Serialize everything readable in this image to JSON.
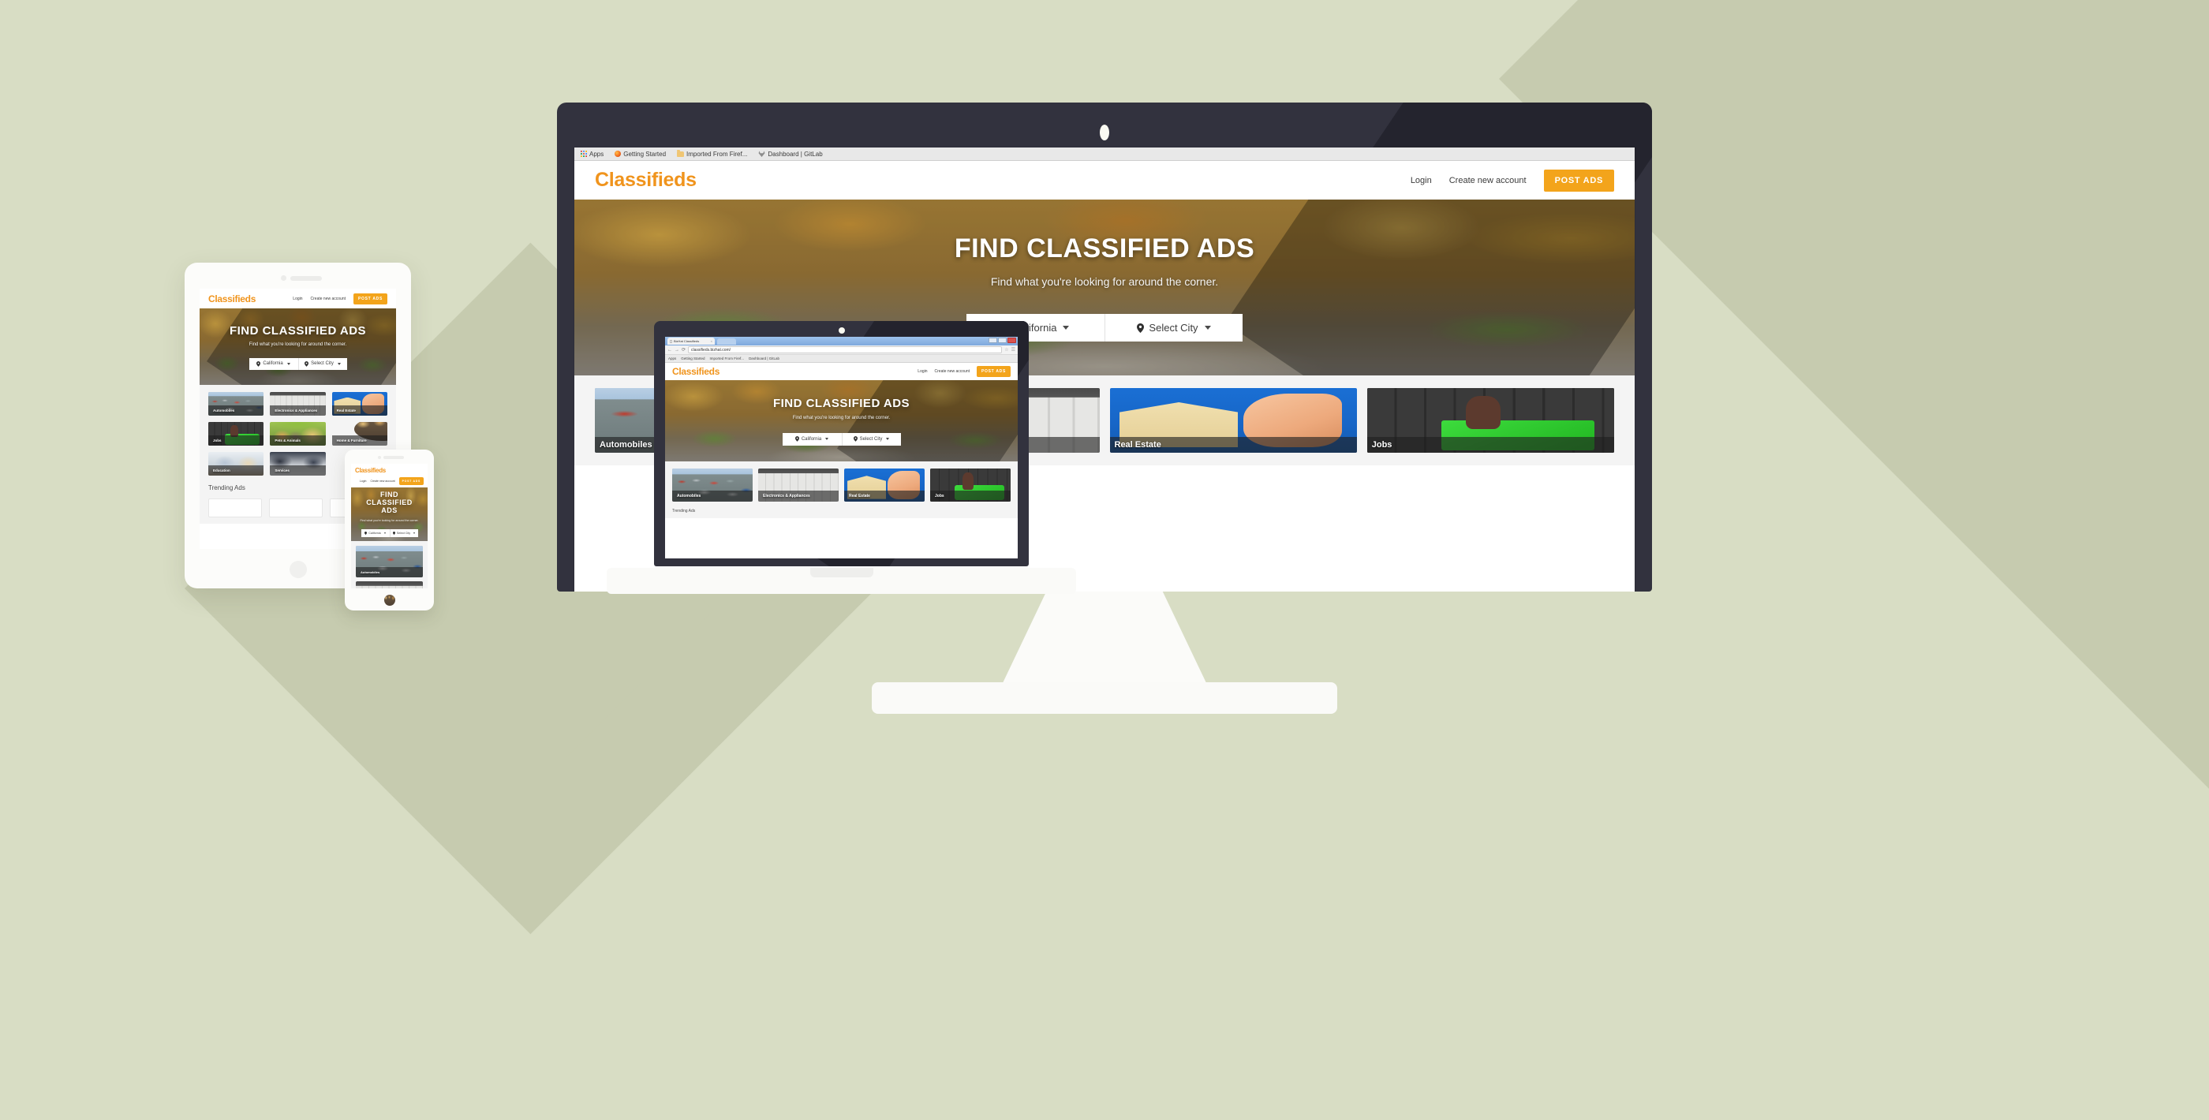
{
  "background": {
    "base_color": "#d8ddc4",
    "shadow_color": "#c6cbaf"
  },
  "browser": {
    "tab_title": "BizHat Classifieds",
    "url": "classifieds.bizhat.com/",
    "bookmarks": [
      {
        "label": "Apps",
        "icon": "apps-grid-icon"
      },
      {
        "label": "Getting Started",
        "icon": "firefox-icon"
      },
      {
        "label": "Imported From Firef...",
        "icon": "folder-icon"
      },
      {
        "label": "Dashboard | GitLab",
        "icon": "gitlab-icon"
      }
    ],
    "window_controls": [
      "minimize",
      "maximize",
      "close"
    ],
    "nav_icons": [
      "back-arrow",
      "forward-arrow",
      "reload",
      "star",
      "menu"
    ]
  },
  "site": {
    "brand": "Classifieds",
    "brand_color": "#f0941d",
    "nav": {
      "login": "Login",
      "create_account": "Create new account",
      "post_ads": "POST ADS",
      "post_ads_color": "#f3a41b"
    },
    "hero": {
      "title": "FIND CLASSIFIED ADS",
      "subtitle": "Find what you're looking for around the corner.",
      "state_selector": "California",
      "city_selector": "Select City"
    },
    "categories": [
      {
        "label": "Automobiles",
        "art": "ph-cars"
      },
      {
        "label": "Electronics & Appliances",
        "art": "ph-appl"
      },
      {
        "label": "Real Estate",
        "art": "ph-realestate"
      },
      {
        "label": "Jobs",
        "art": "ph-jobs"
      },
      {
        "label": "Pets & Animals",
        "art": "ph-pets"
      },
      {
        "label": "Home & Furniture",
        "art": "ph-home"
      },
      {
        "label": "Education",
        "art": "ph-edu"
      },
      {
        "label": "Services",
        "art": "ph-serv"
      }
    ],
    "trending_heading": "Trending Ads"
  },
  "devices": {
    "desktop": "desktop-monitor",
    "tablet": "tablet",
    "phone": "phone",
    "laptop": "laptop"
  }
}
